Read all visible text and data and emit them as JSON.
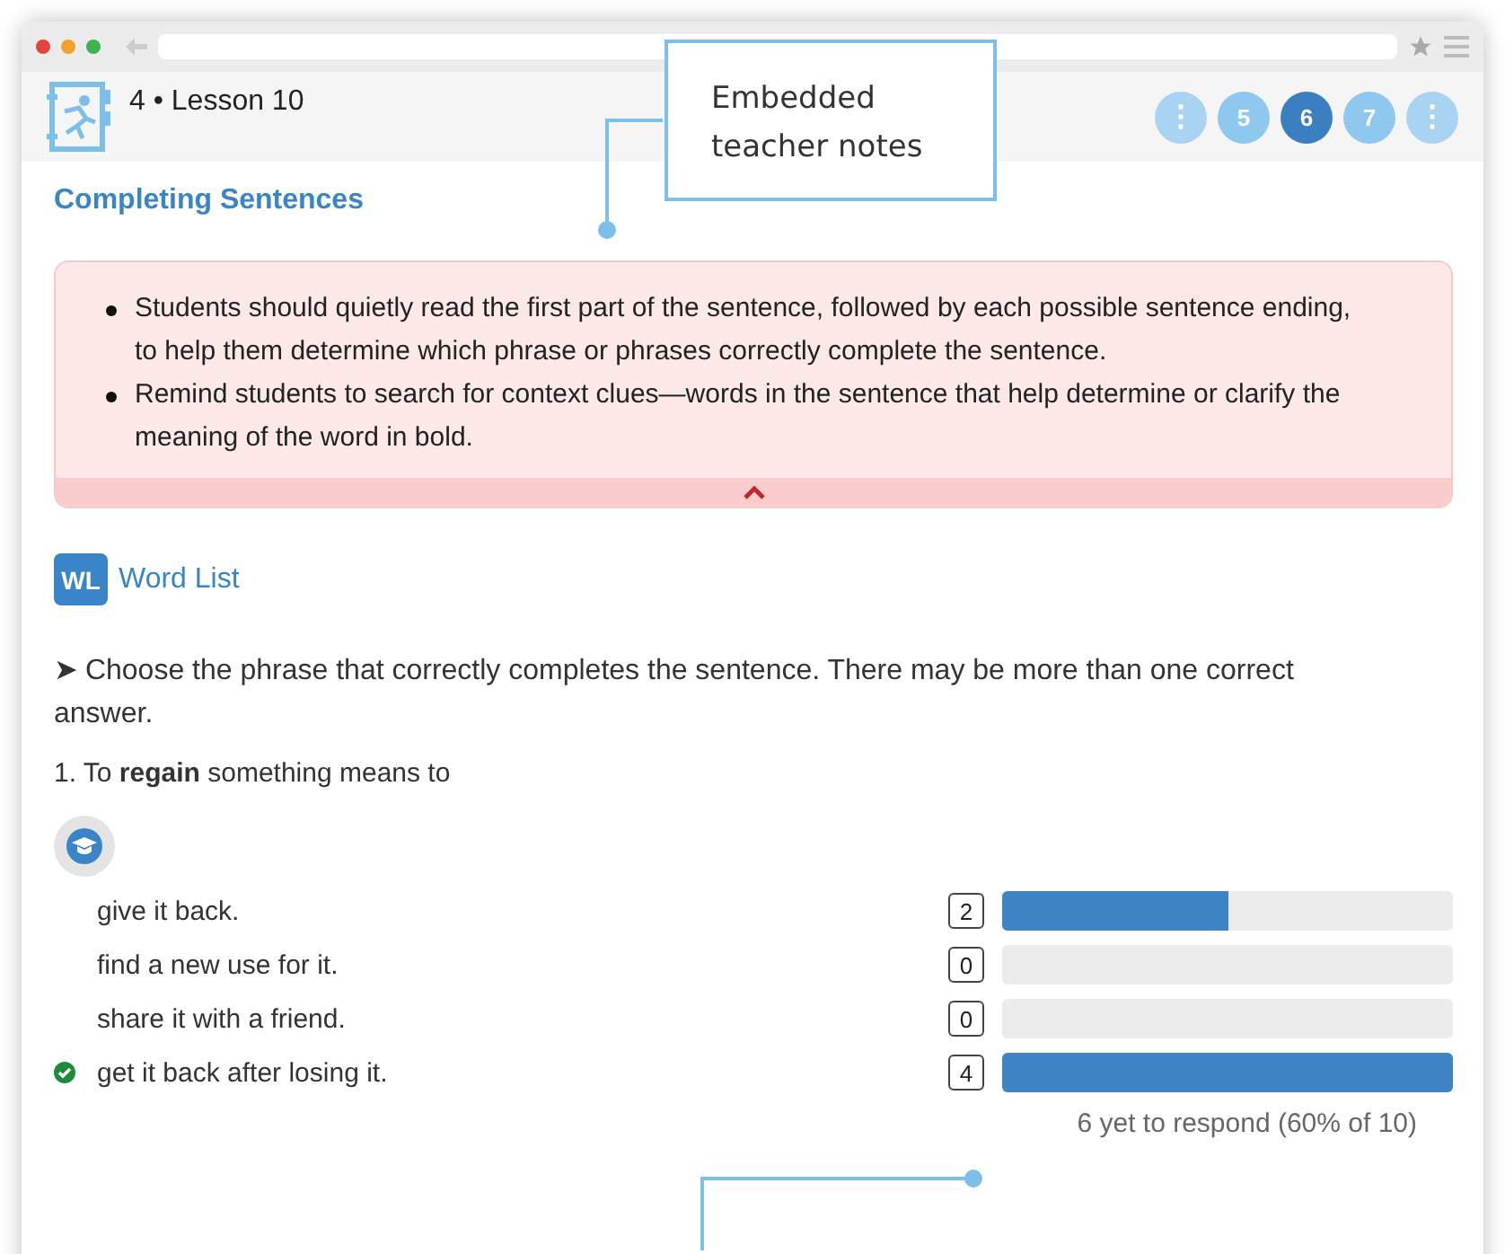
{
  "header": {
    "title": "4 • Lesson 10",
    "pages": [
      {
        "kind": "more",
        "label": "⋮",
        "selected": false
      },
      {
        "kind": "page",
        "label": "5",
        "selected": false
      },
      {
        "kind": "page",
        "label": "6",
        "selected": true
      },
      {
        "kind": "page",
        "label": "7",
        "selected": false
      },
      {
        "kind": "more",
        "label": "⋮",
        "selected": false
      }
    ]
  },
  "section_title": "Completing Sentences",
  "teacher_notes": {
    "expanded": true,
    "items": [
      "Students should quietly read the first part of the sentence, followed by each possible sentence ending, to help them determine which phrase or phrases correctly complete the sentence.",
      "Remind students to search for context clues—words in the sentence that help determine or clarify the meaning of the word in bold."
    ]
  },
  "word_list": {
    "badge": "WL",
    "label": "Word List"
  },
  "instruction": "➤ Choose the phrase that correctly completes the sentence. There may be more than one correct answer.",
  "question": "1. To **regain** something means to",
  "answers": [
    {
      "text": "give it back.",
      "count": "2",
      "level": 0.5,
      "correct": false
    },
    {
      "text": "find a new use for it.",
      "count": "0",
      "level": 0,
      "correct": false
    },
    {
      "text": "share it with a friend.",
      "count": "0",
      "level": 0,
      "correct": false
    },
    {
      "text": "get it back after losing it.",
      "count": "4",
      "level": 1,
      "correct": true
    }
  ],
  "response_status": "6 yet to respond (60% of 10)",
  "callout": "Embedded teacher notes"
}
